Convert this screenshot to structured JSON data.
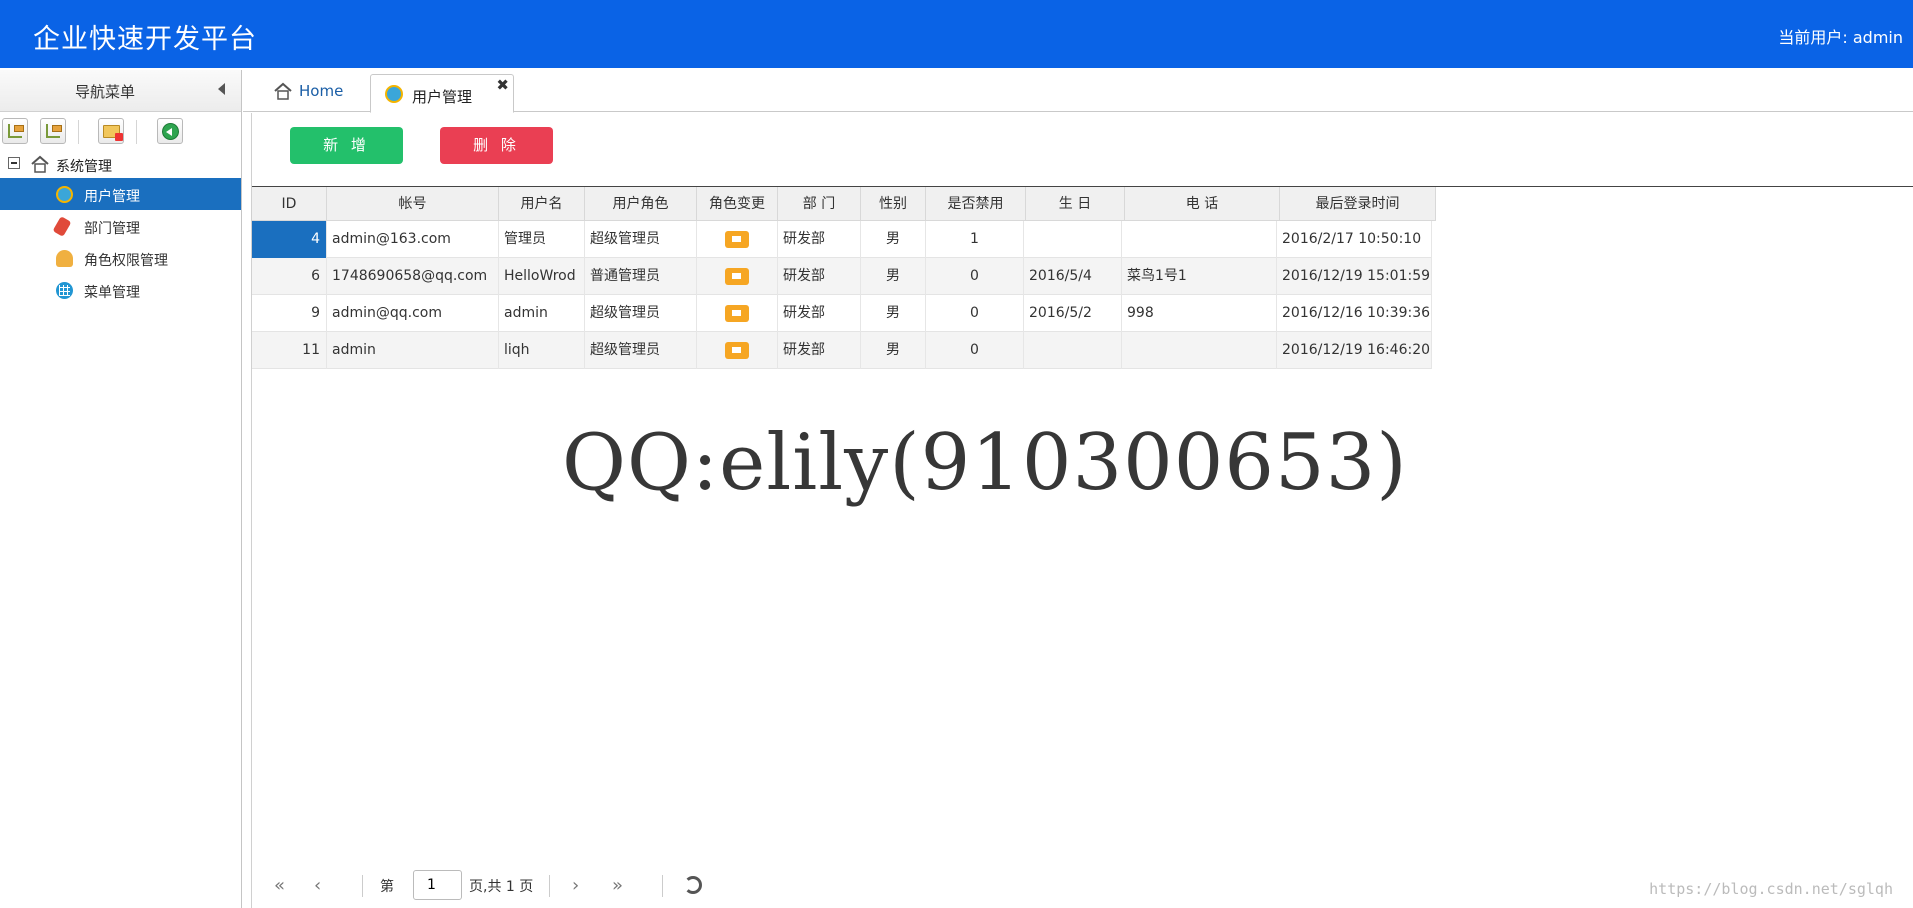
{
  "header": {
    "title": "企业快速开发平台",
    "current_user": "当前用户: admin"
  },
  "sidebar": {
    "title": "导航菜单",
    "root": "系统管理",
    "items": [
      {
        "label": "用户管理",
        "icon": "users-icon",
        "active": true
      },
      {
        "label": "部门管理",
        "icon": "department-icon",
        "active": false
      },
      {
        "label": "角色权限管理",
        "icon": "role-icon",
        "active": false
      },
      {
        "label": "菜单管理",
        "icon": "grid-icon",
        "active": false
      }
    ]
  },
  "tabs": [
    {
      "label": "Home",
      "icon": "home-icon"
    },
    {
      "label": "用户管理",
      "icon": "users-icon",
      "close": "✖"
    }
  ],
  "toolbar": {
    "add_label": "新 增",
    "delete_label": "删 除"
  },
  "table": {
    "headers": [
      "ID",
      "帐号",
      "用户名",
      "用户角色",
      "角色变更",
      "部 门",
      "性别",
      "是否禁用",
      "生 日",
      "电 话",
      "最后登录时间"
    ],
    "rows": [
      [
        "4",
        "admin@163.com",
        "管理员",
        "超级管理员",
        "",
        "研发部",
        "男",
        "1",
        "",
        "",
        "2016/2/17 10:50:10"
      ],
      [
        "6",
        "1748690658@qq.com",
        "HelloWrod",
        "普通管理员",
        "",
        "研发部",
        "男",
        "0",
        "2016/5/4",
        "菜鸟1号1",
        "2016/12/19 15:01:59"
      ],
      [
        "9",
        "admin@qq.com",
        "admin",
        "超级管理员",
        "",
        "研发部",
        "男",
        "0",
        "2016/5/2",
        "998",
        "2016/12/16 10:39:36"
      ],
      [
        "11",
        "admin",
        "liqh",
        "超级管理员",
        "",
        "研发部",
        "男",
        "0",
        "",
        "",
        "2016/12/19 16:46:20"
      ]
    ]
  },
  "watermark": "QQ:elily(910300653)",
  "pager": {
    "page_prefix": "第",
    "page_value": "1",
    "page_suffix": "页,共 1 页"
  },
  "url_watermark": "https://blog.csdn.net/sglqh",
  "colors": {
    "header": "#0a63e6",
    "active": "#1a6fbf",
    "add": "#23c06b",
    "delete": "#ea3f53",
    "flag": "#f6a623"
  }
}
